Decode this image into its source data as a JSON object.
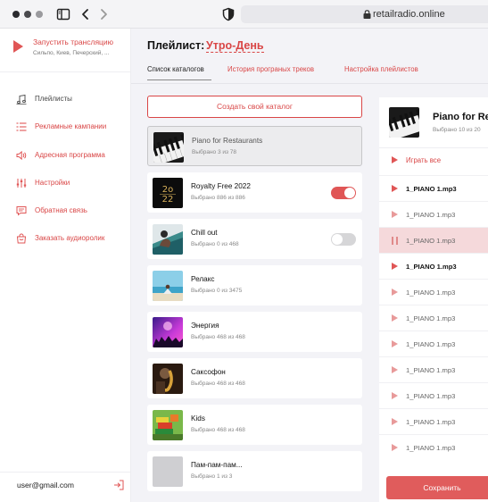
{
  "browser": {
    "url": "retailradio.online"
  },
  "sidebar": {
    "broadcast": {
      "title": "Запустить трансляцию",
      "subtitle": "Сильпо, Киев, Печерский, ..."
    },
    "items": [
      {
        "label": "Плейлисты",
        "icon": "music-note-icon",
        "style": "plain"
      },
      {
        "label": "Рекламные кампании",
        "icon": "list-icon",
        "style": "red"
      },
      {
        "label": "Адресная программа",
        "icon": "speaker-icon",
        "style": "red"
      },
      {
        "label": "Настройки",
        "icon": "sliders-icon",
        "style": "red"
      },
      {
        "label": "Обратная связь",
        "icon": "chat-icon",
        "style": "red"
      },
      {
        "label": "Заказать аудиоролик",
        "icon": "bag-icon",
        "style": "red"
      }
    ],
    "user_email": "user@gmail.com"
  },
  "header": {
    "title_label": "Плейлист:",
    "title_value": "Утро-День",
    "tabs": [
      {
        "label": "Список каталогов",
        "active": true
      },
      {
        "label": "История програных треков",
        "active": false
      },
      {
        "label": "Настройка плейлистов",
        "active": false
      }
    ]
  },
  "catalogs": {
    "create_label": "Создать свой каталог",
    "items": [
      {
        "name": "Piano for Restaurants",
        "count": "Выбрано 3 из 78",
        "thumb": "piano",
        "selected": true,
        "toggle": null
      },
      {
        "name": "Royalty Free 2022",
        "count": "Выбрано 886 из 886",
        "thumb": "royalty",
        "selected": false,
        "toggle": true
      },
      {
        "name": "Chill out",
        "count": "Выбрано 0 из 468",
        "thumb": "chill",
        "selected": false,
        "toggle": false
      },
      {
        "name": "Релакс",
        "count": "Выбрано 0 из 3475",
        "thumb": "relax",
        "selected": false,
        "toggle": null
      },
      {
        "name": "Энергия",
        "count": "Выбрано 468 из 468",
        "thumb": "energy",
        "selected": false,
        "toggle": null
      },
      {
        "name": "Саксофон",
        "count": "Выбрано 468 из 468",
        "thumb": "sax",
        "selected": false,
        "toggle": null
      },
      {
        "name": "Kids",
        "count": "Выбрано 468 из 468",
        "thumb": "kids",
        "selected": false,
        "toggle": null
      },
      {
        "name": "Пам-пам-пам...",
        "count": "Выбрано 1 из 3",
        "thumb": "blank",
        "selected": false,
        "toggle": null
      }
    ]
  },
  "panel": {
    "title": "Piano for Re",
    "subtitle": "Выбрано 10 из 20",
    "play_all_label": "Играть все",
    "tracks": [
      {
        "name": "1_PIANO 1.mp3",
        "state": "bold"
      },
      {
        "name": "1_PIANO 1.mp3",
        "state": "normal"
      },
      {
        "name": "1_PIANO 1.mp3",
        "state": "playing"
      },
      {
        "name": "1_PIANO 1.mp3",
        "state": "bold"
      },
      {
        "name": "1_PIANO 1.mp3",
        "state": "normal"
      },
      {
        "name": "1_PIANO 1.mp3",
        "state": "normal"
      },
      {
        "name": "1_PIANO 1.mp3",
        "state": "normal"
      },
      {
        "name": "1_PIANO 1.mp3",
        "state": "normal"
      },
      {
        "name": "1_PIANO 1.mp3",
        "state": "normal"
      },
      {
        "name": "1_PIANO 1.mp3",
        "state": "normal"
      },
      {
        "name": "1_PIANO 1.mp3",
        "state": "normal"
      }
    ],
    "save_label": "Сохранить"
  },
  "colors": {
    "accent": "#e05656",
    "accent_text": "#d94646"
  }
}
